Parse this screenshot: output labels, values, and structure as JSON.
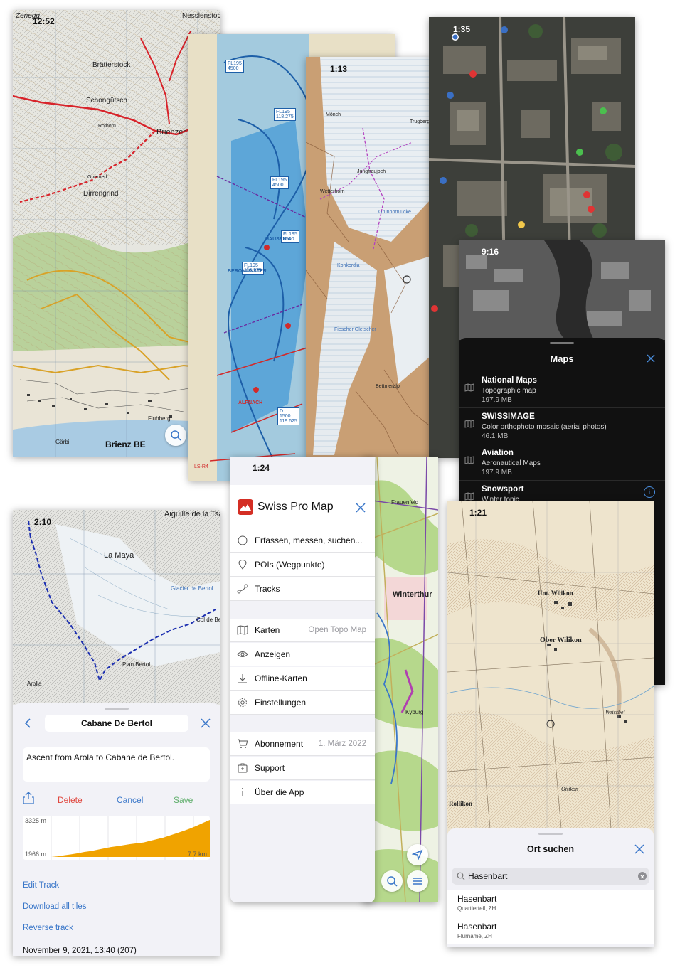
{
  "topo1": {
    "time": "12:52",
    "labels": [
      "Zenegg",
      "Nesslenstoc",
      "Brätterstock",
      "Schongütsch",
      "Brienzer Rothorn",
      "Dirrengrind",
      "Brienz BE",
      "Oberried",
      "Fluhberg",
      "Gärbi",
      "Rothorn"
    ]
  },
  "aviation": {
    "badges": [
      "FL195\n4500",
      "FL195\n118.275",
      "FL195\n4500",
      "FL195\n118.275",
      "D\n1500\n119.625",
      "HAUSEN A",
      "BEROMÜNSTER",
      "ALPNACH",
      "LS-R4",
      "FL195\n4500"
    ]
  },
  "glacier": {
    "time": "1:13",
    "labels": [
      "Trugberg",
      "Jungfraujoch",
      "Mönch",
      "Wetterhorn",
      "Grünhornlücke",
      "Konkordia",
      "Bettmeralp",
      "Fiescher Gletscher"
    ]
  },
  "aerial": {
    "time": "1:35"
  },
  "bw": {
    "time": "9:16"
  },
  "maps_sheet": {
    "title": "Maps",
    "items": [
      {
        "name": "National Maps",
        "desc": "Topographic map",
        "size": "197.9 MB"
      },
      {
        "name": "SWISSIMAGE",
        "desc": "Color orthophoto mosaic (aerial photos)",
        "size": "46.1 MB"
      },
      {
        "name": "Aviation",
        "desc": "Aeronautical Maps",
        "size": "197.9 MB"
      },
      {
        "name": "Snowsport",
        "desc": "Winter topic",
        "size": ""
      }
    ]
  },
  "menu": {
    "time": "1:24",
    "app_name": "Swiss Pro Map",
    "group1": [
      {
        "icon": "circle-icon",
        "label": "Erfassen, messen, suchen..."
      },
      {
        "icon": "pin-icon",
        "label": "POIs (Wegpunkte)"
      },
      {
        "icon": "track-icon",
        "label": "Tracks"
      }
    ],
    "group2": [
      {
        "icon": "map-icon",
        "label": "Karten",
        "value": "Open Topo Map"
      },
      {
        "icon": "eye-icon",
        "label": "Anzeigen",
        "value": ""
      },
      {
        "icon": "download-icon",
        "label": "Offline-Karten",
        "value": ""
      },
      {
        "icon": "gear-icon",
        "label": "Einstellungen",
        "value": ""
      }
    ],
    "group3": [
      {
        "icon": "cart-icon",
        "label": "Abonnement",
        "value": "1. März 2022"
      },
      {
        "icon": "support-icon",
        "label": "Support",
        "value": ""
      },
      {
        "icon": "info-icon",
        "label": "Über die App",
        "value": ""
      }
    ]
  },
  "openmap": {
    "labels": [
      "Winterthur",
      "Frauenfeld",
      "Kyburg"
    ]
  },
  "track": {
    "time": "2:10",
    "map_labels": [
      "Aiguille de la Tsa",
      "La Maya",
      "Glacier de Bertol",
      "Col de Bertol",
      "Plan Bertol",
      "Arolla"
    ],
    "title": "Cabane De Bertol",
    "description": "Ascent from Arola to Cabane de Bertol.",
    "delete": "Delete",
    "cancel": "Cancel",
    "save": "Save",
    "elev_max": "3325 m",
    "elev_min": "1966 m",
    "distance": "7.7 km",
    "elevation_profile": [
      1966,
      1990,
      2030,
      2060,
      2100,
      2150,
      2180,
      2230,
      2280,
      2330,
      2360,
      2400,
      2440,
      2470,
      2500,
      2560,
      2620,
      2680,
      2760,
      2840,
      2920,
      3010,
      3110,
      3220,
      3325
    ],
    "edit_track": "Edit Track",
    "download_tiles": "Download all tiles",
    "reverse_track": "Reverse track",
    "timestamp": "November 9, 2021, 13:40  (207)"
  },
  "historic": {
    "time": "1:21",
    "labels": [
      "Ober Wilikon",
      "Unt. Wilikon",
      "Weissbel",
      "Ottikon",
      "Rollikon"
    ],
    "search_title": "Ort suchen",
    "search_value": "Hasenbart",
    "results": [
      {
        "name": "Hasenbart",
        "type": "Quartierteil, ZH"
      },
      {
        "name": "Hasenbart",
        "type": "Flurname, ZH"
      }
    ]
  },
  "colors": {
    "accent": "#3a77c9",
    "save_green": "#5fae6b",
    "delete_red": "#e0483f",
    "elevation_fill": "#f0a300",
    "swiss_red": "#d42e24"
  }
}
